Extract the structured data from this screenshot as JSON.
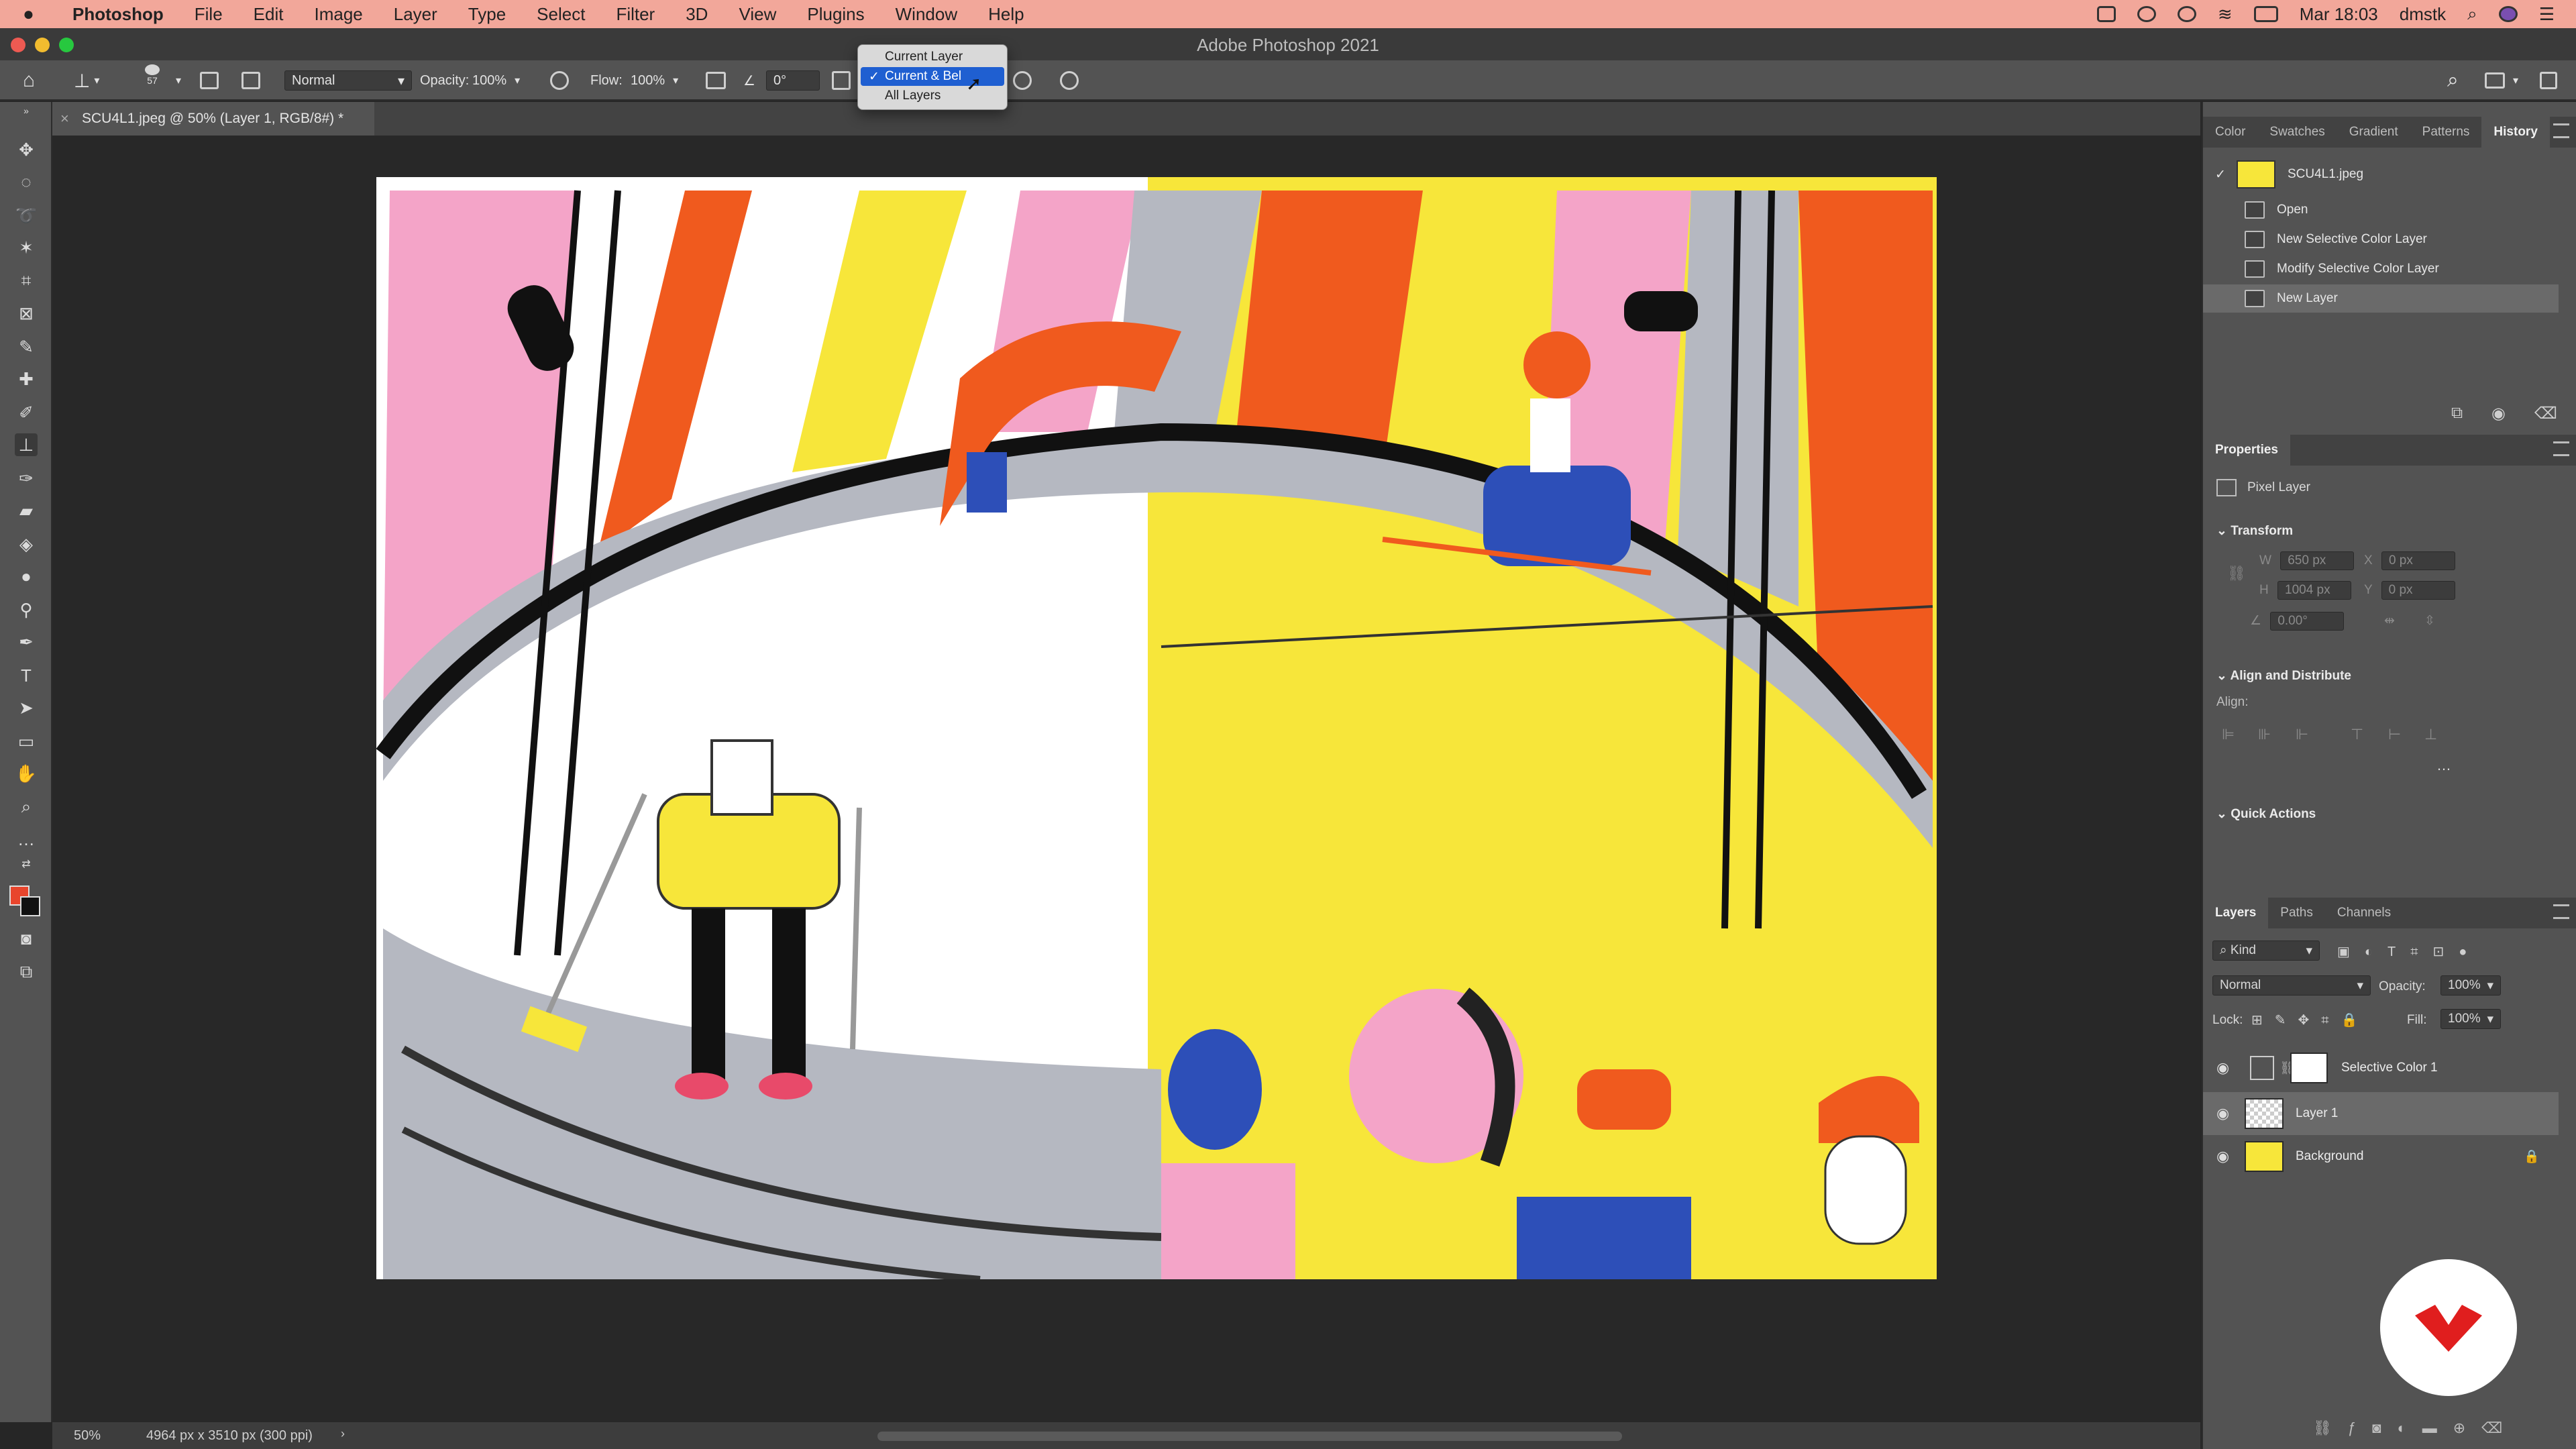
{
  "menubar": {
    "app": "Photoshop",
    "items": [
      "File",
      "Edit",
      "Image",
      "Layer",
      "Type",
      "Select",
      "Filter",
      "3D",
      "View",
      "Plugins",
      "Window",
      "Help"
    ],
    "clock": "Mar 18:03",
    "user": "dmstk"
  },
  "window": {
    "title": "Adobe Photoshop 2021"
  },
  "options": {
    "brush_size": "57",
    "mode": "Normal",
    "opacity_label": "Opacity:",
    "opacity": "100%",
    "flow_label": "Flow:",
    "flow": "100%",
    "angle": "0°"
  },
  "sample_dropdown": {
    "options": [
      "Current Layer",
      "Current & Below",
      "All Layers"
    ],
    "selected": "Current & Below",
    "selected_visible": "Current & Bel"
  },
  "document": {
    "tab": "SCU4L1.jpeg @ 50% (Layer 1, RGB/8#) *"
  },
  "status": {
    "zoom": "50%",
    "info": "4964 px x 3510 px (300 ppi)"
  },
  "history_panel": {
    "tabs": [
      "Color",
      "Swatches",
      "Gradient",
      "Patterns",
      "History"
    ],
    "active_tab": "History",
    "snapshot": "SCU4L1.jpeg",
    "states": [
      "Open",
      "New Selective Color Layer",
      "Modify Selective Color Layer",
      "New Layer"
    ],
    "selected": "New Layer"
  },
  "properties_panel": {
    "title": "Properties",
    "kind": "Pixel Layer",
    "transform": "Transform",
    "w": "650 px",
    "h": "1004 px",
    "x": "0 px",
    "y": "0 px",
    "angle": "0.00°",
    "align_section": "Align and Distribute",
    "align_label": "Align:",
    "quick_actions": "Quick Actions"
  },
  "layers_panel": {
    "tabs": [
      "Layers",
      "Paths",
      "Channels"
    ],
    "active_tab": "Layers",
    "filter": "Kind",
    "blend": "Normal",
    "opacity_label": "Opacity:",
    "opacity": "100%",
    "lock_label": "Lock:",
    "fill_label": "Fill:",
    "fill": "100%",
    "layers": [
      "Selective Color 1",
      "Layer 1",
      "Background"
    ],
    "selected": "Layer 1"
  },
  "colors": {
    "menubar": "#f2a79a",
    "foreground": "#e8452c",
    "background": "#111111",
    "highlight": "#1f5fd1",
    "art_yellow": "#f7e63a",
    "art_orange": "#f05a1e",
    "art_pink": "#f4a4c8",
    "art_gray": "#b5b8c1",
    "art_blue": "#2d4fb8",
    "logo_red": "#e01e1e"
  }
}
